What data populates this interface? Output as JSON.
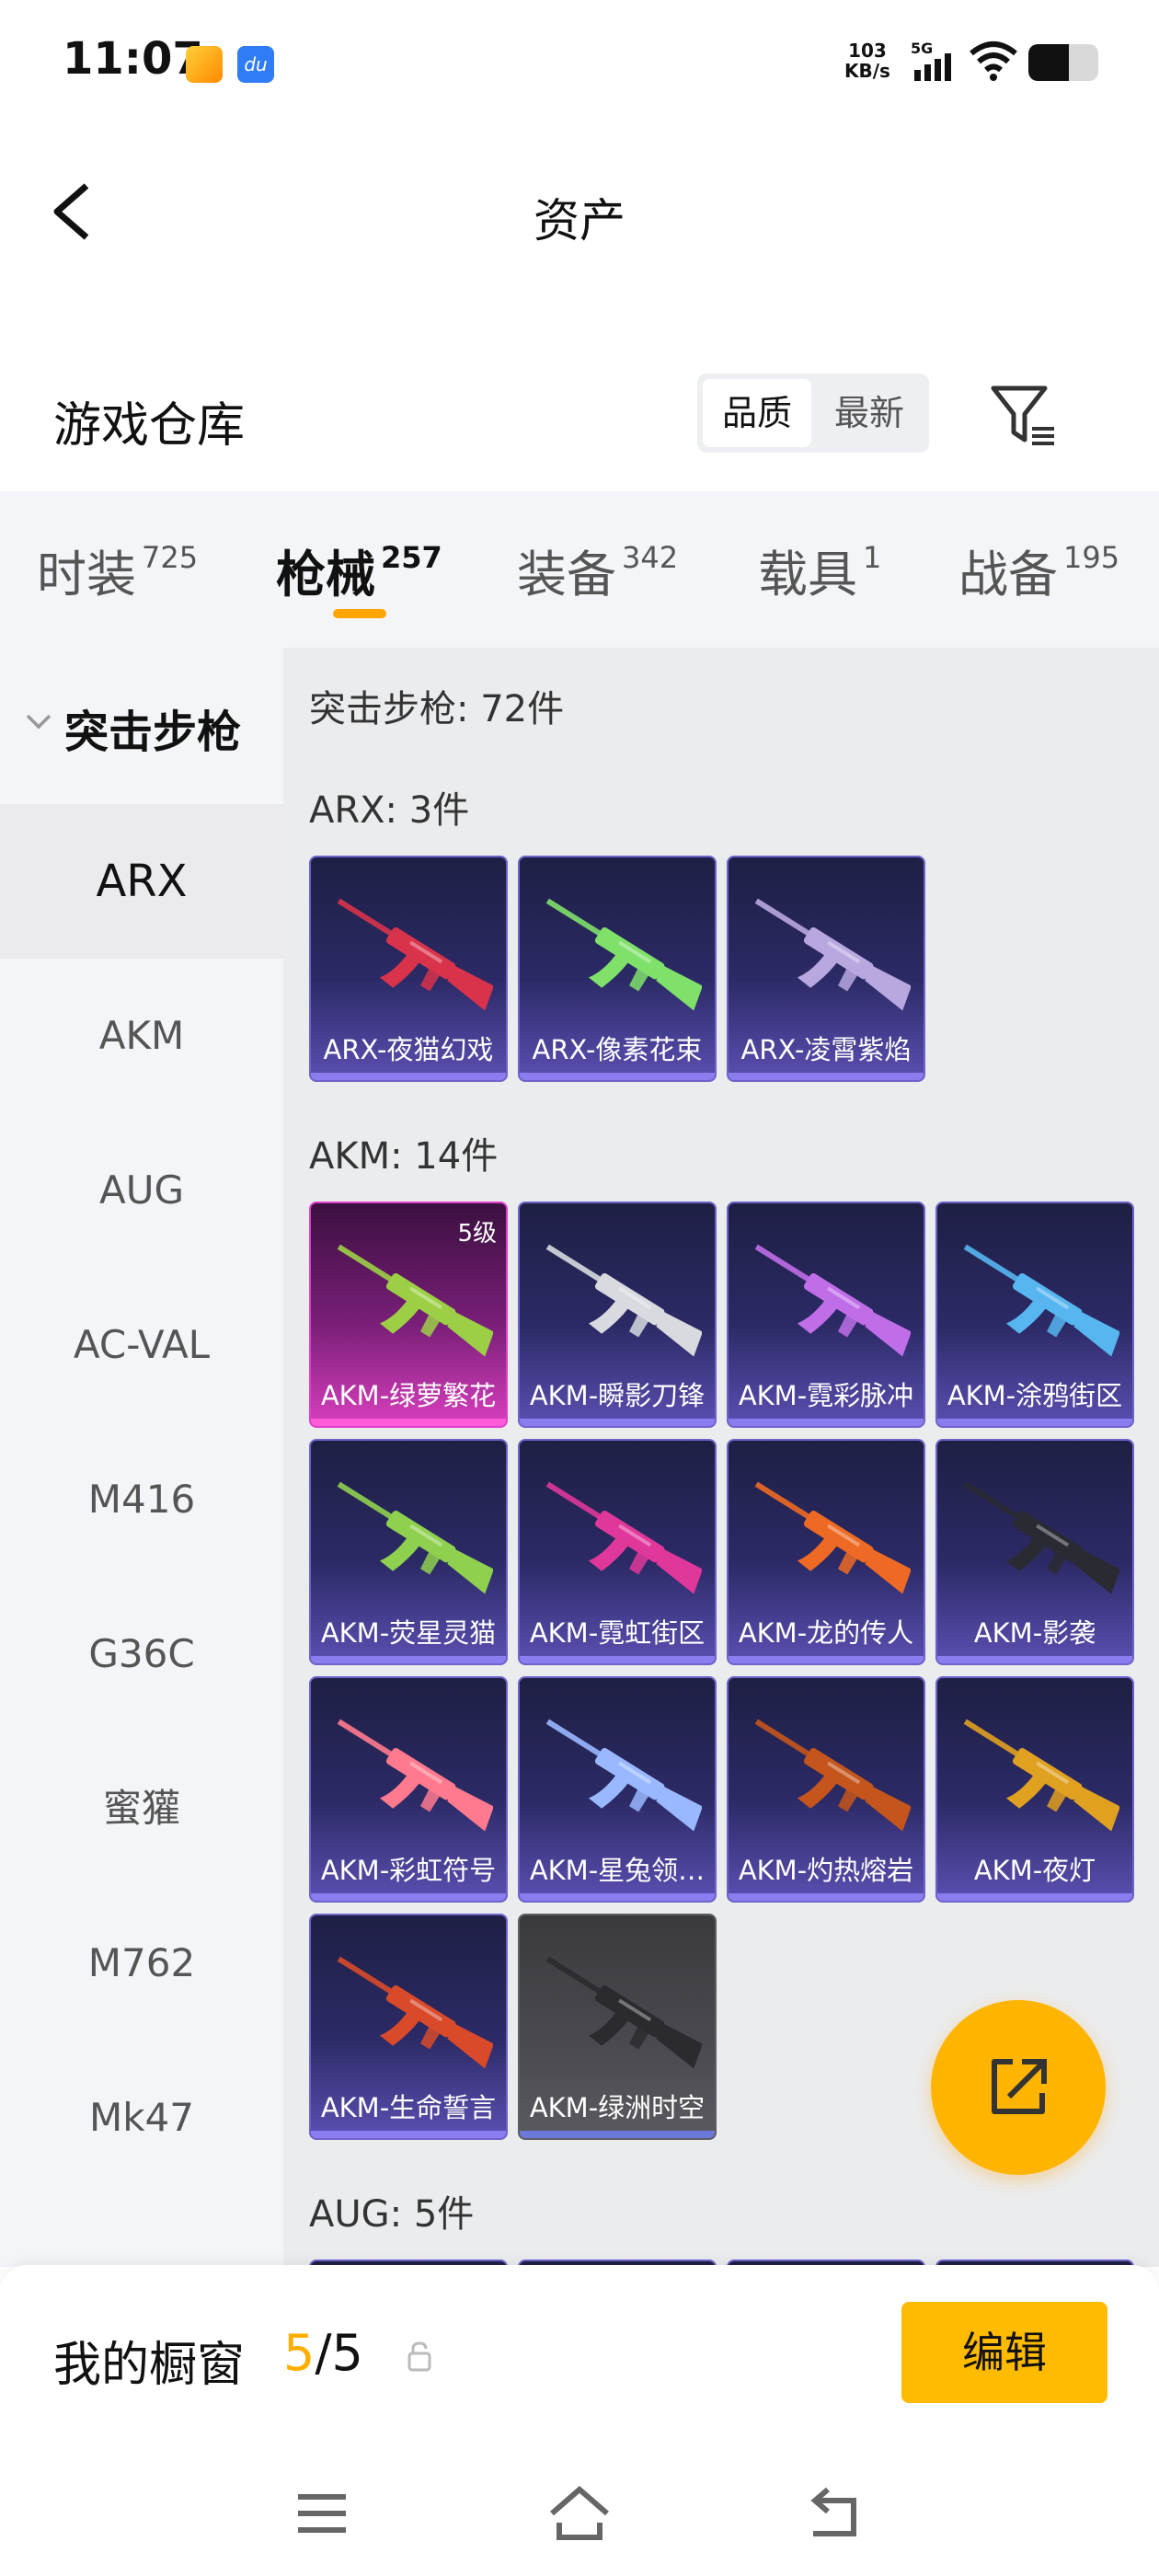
{
  "status_bar": {
    "time": "11:07",
    "speed_value": "103",
    "speed_unit": "KB/s",
    "network": "5G"
  },
  "header": {
    "title": "资产"
  },
  "section": {
    "title": "游戏仓库",
    "sort_options": [
      "品质",
      "最新"
    ],
    "sort_selected": "品质"
  },
  "tabs": [
    {
      "label": "时装",
      "count": "725"
    },
    {
      "label": "枪械",
      "count": "257"
    },
    {
      "label": "装备",
      "count": "342"
    },
    {
      "label": "载具",
      "count": "1"
    },
    {
      "label": "战备",
      "count": "195"
    }
  ],
  "sidebar": {
    "category": "突击步枪",
    "items": [
      "ARX",
      "AKM",
      "AUG",
      "AC-VAL",
      "M416",
      "G36C",
      "蜜獾",
      "M762",
      "Mk47"
    ],
    "active_item": "ARX"
  },
  "content": {
    "category_summary": "突击步枪: 72件",
    "groups": [
      {
        "label": "ARX: 3件",
        "items": [
          {
            "name": "ARX-夜猫幻戏",
            "gun_color": "#d8334a"
          },
          {
            "name": "ARX-像素花束",
            "gun_color": "#7fe06a"
          },
          {
            "name": "ARX-凌霄紫焰",
            "gun_color": "#b9a8e0"
          }
        ]
      },
      {
        "label": "AKM: 14件",
        "items": [
          {
            "name": "AKM-绿萝繁花",
            "level": "5级",
            "gun_color": "#9ccf46",
            "rarity": "pink"
          },
          {
            "name": "AKM-瞬影刀锋",
            "gun_color": "#d8dadf"
          },
          {
            "name": "AKM-霓彩脉冲",
            "gun_color": "#c06ee8"
          },
          {
            "name": "AKM-涂鸦街区",
            "gun_color": "#57b6f0"
          },
          {
            "name": "AKM-荧星灵猫",
            "gun_color": "#8fd14f"
          },
          {
            "name": "AKM-霓虹街区",
            "gun_color": "#e0379a"
          },
          {
            "name": "AKM-龙的传人",
            "gun_color": "#ee6a24"
          },
          {
            "name": "AKM-影袭",
            "gun_color": "#2a2a33"
          },
          {
            "name": "AKM-彩虹符号",
            "gun_color": "#ff7a8e"
          },
          {
            "name": "AKM-星兔领…",
            "gun_color": "#9ab8ff"
          },
          {
            "name": "AKM-灼热熔岩",
            "gun_color": "#c4551c"
          },
          {
            "name": "AKM-夜灯",
            "gun_color": "#e0a020"
          },
          {
            "name": "AKM-生命誓言",
            "gun_color": "#d84a2a"
          },
          {
            "name": "AKM-绿洲时空",
            "gun_color": "#2b2b2f",
            "rarity": "grey"
          }
        ]
      },
      {
        "label": "AUG: 5件",
        "items": []
      }
    ]
  },
  "bottom_bar": {
    "showcase_label": "我的橱窗",
    "showcase_current": "5",
    "showcase_total": "/5",
    "edit_label": "编辑"
  },
  "colors": {
    "accent": "#ffb400",
    "tab_underline": "#ffa500",
    "card_purple": "#2c2a66",
    "card_pink": "#d93fbe"
  }
}
